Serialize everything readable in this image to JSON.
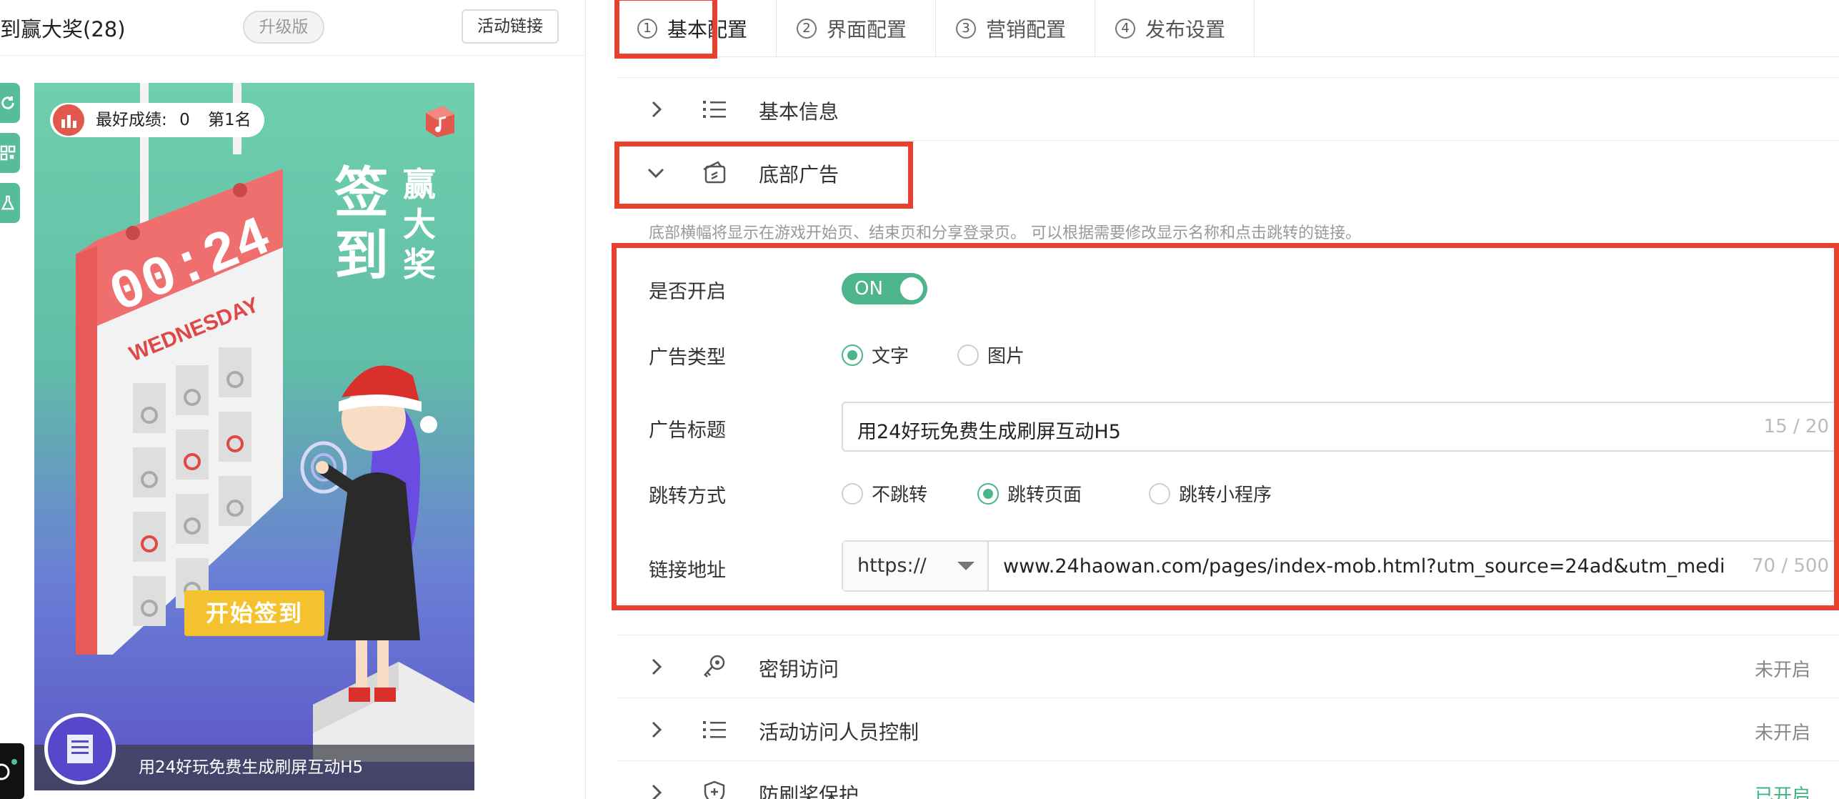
{
  "left": {
    "project_title": "到赢大奖(28)",
    "upgrade_label": "升级版",
    "activity_link_label": "活动链接",
    "side_tools": [
      "refresh-icon",
      "qrcode-icon",
      "flask-icon"
    ],
    "phone": {
      "score_label": "最好成绩:",
      "score_value": "0",
      "rank_label": "第1名",
      "calendar_time": "00:24",
      "calendar_day": "WEDNESDAY",
      "title_big": [
        "签",
        "到"
      ],
      "title_small": [
        "赢",
        "大",
        "奖"
      ],
      "start_button": "开始签到",
      "ad_text": "用24好玩免费生成刷屏互动H5"
    }
  },
  "tabs": [
    {
      "num": "1",
      "label": "基本配置",
      "active": true
    },
    {
      "num": "2",
      "label": "界面配置",
      "active": false
    },
    {
      "num": "3",
      "label": "营销配置",
      "active": false
    },
    {
      "num": "4",
      "label": "发布设置",
      "active": false
    }
  ],
  "sections": {
    "basic_info": {
      "label": "基本信息"
    },
    "bottom_ad": {
      "label": "底部广告"
    },
    "secret_access": {
      "label": "密钥访问",
      "status": "未开启"
    },
    "visitor_control": {
      "label": "活动访问人员控制",
      "status": "未开启"
    },
    "anti_fraud": {
      "label": "防刷奖保护",
      "status": "已开启"
    }
  },
  "bottom_ad_form": {
    "hint": "底部横幅将显示在游戏开始页、结束页和分享登录页。 可以根据需要修改显示名称和点击跳转的链接。",
    "enable_label": "是否开启",
    "enable_value": "ON",
    "ad_type_label": "广告类型",
    "ad_type_options": [
      "文字",
      "图片"
    ],
    "ad_type_selected": "文字",
    "ad_title_label": "广告标题",
    "ad_title_value": "用24好玩免费生成刷屏互动H5",
    "ad_title_count": "15 / 20",
    "jump_label": "跳转方式",
    "jump_options": [
      "不跳转",
      "跳转页面",
      "跳转小程序"
    ],
    "jump_selected": "跳转页面",
    "link_label": "链接地址",
    "link_prefix": "https://",
    "link_value": "www.24haowan.com/pages/index-mob.html?utm_source=24ad&utm_medi",
    "link_count": "70 / 500"
  },
  "colors": {
    "accent_green": "#4cb58b",
    "highlight_red": "#e8412f",
    "status_on": "#3fb37f"
  }
}
